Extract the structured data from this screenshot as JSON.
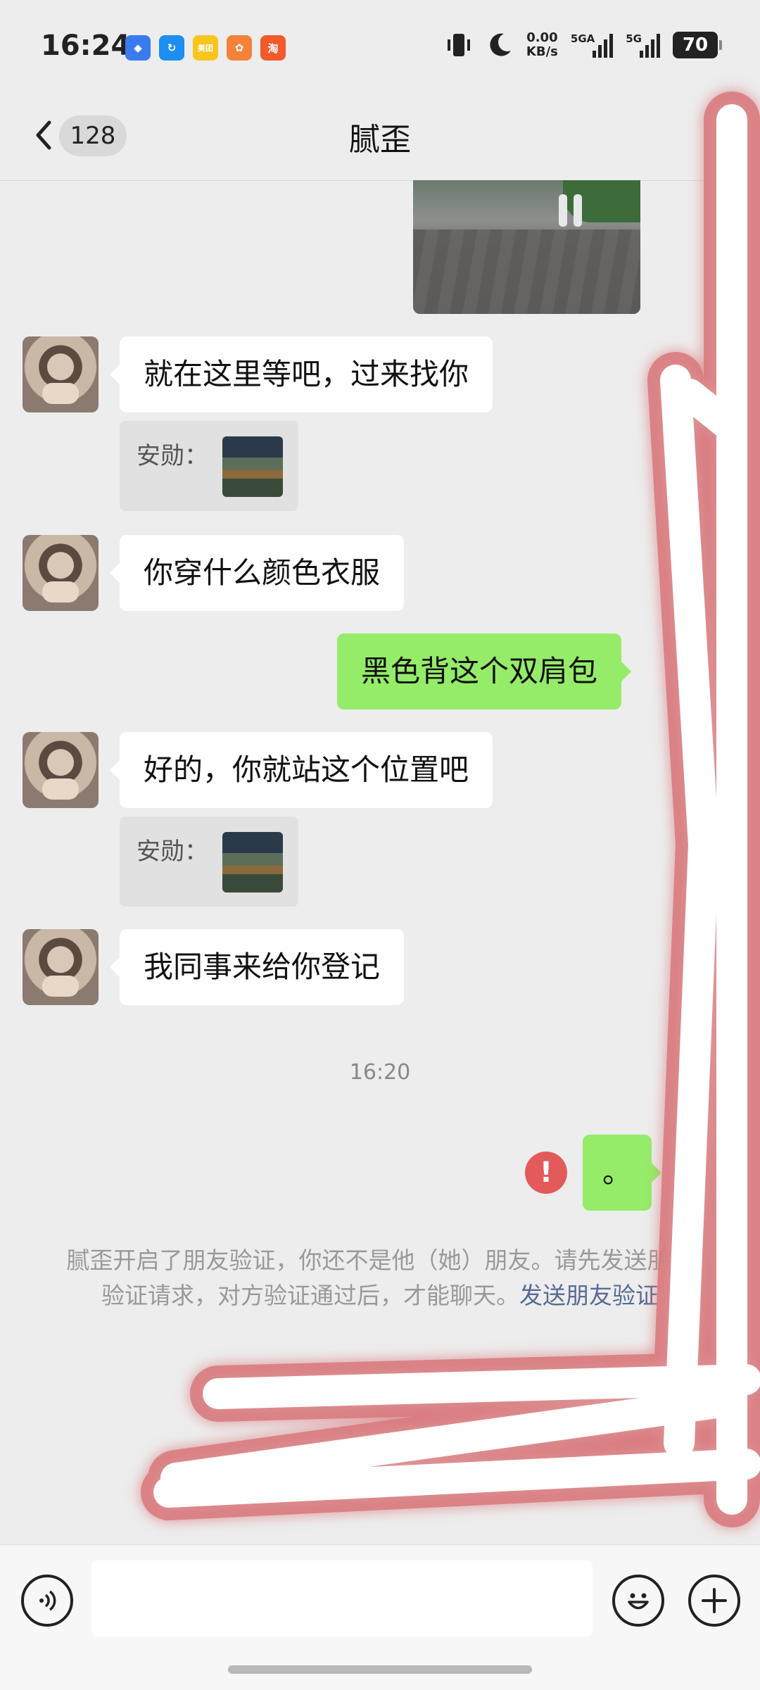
{
  "status_bar": {
    "time": "16:24",
    "app_icons": [
      {
        "name": "blue-app-icon",
        "color": "#3a7bf0",
        "glyph": "◆"
      },
      {
        "name": "travel-app-icon",
        "color": "#1e8ef0",
        "glyph": "↻"
      },
      {
        "name": "meituan-icon",
        "color": "#f8c51c",
        "glyph": "美团"
      },
      {
        "name": "orange-app-icon",
        "color": "#f5813a",
        "glyph": "✿"
      },
      {
        "name": "taobao-icon",
        "color": "#f25a2c",
        "glyph": "淘"
      }
    ],
    "net_speed_value": "0.00",
    "net_speed_unit": "KB/s",
    "signal1_label": "5GA",
    "signal2_label": "5G",
    "battery": "70"
  },
  "nav": {
    "unread_count": "128",
    "title": "腻歪"
  },
  "messages": {
    "m1": "就在这里等吧，过来找你",
    "m1_quote_label": "安勋：",
    "m2": "你穿什么颜色衣服",
    "m3": "黑色背这个双肩包",
    "m4": "好的，你就站这个位置吧",
    "m4_quote_label": "安勋：",
    "m5": "我同事来给你登记",
    "timestamp": "16:20",
    "m6": "。",
    "error_mark": "!"
  },
  "system_notice": {
    "text": "腻歪开启了朋友验证，你还不是他（她）朋友。请先发送朋友验证请求，对方验证通过后，才能聊天。",
    "link": "发送朋友验证"
  },
  "input_bar": {
    "placeholder": ""
  },
  "colors": {
    "background": "#ededed",
    "incoming_bubble": "#ffffff",
    "outgoing_bubble": "#95ec69",
    "link": "#576b95",
    "error": "#e35a5a"
  }
}
